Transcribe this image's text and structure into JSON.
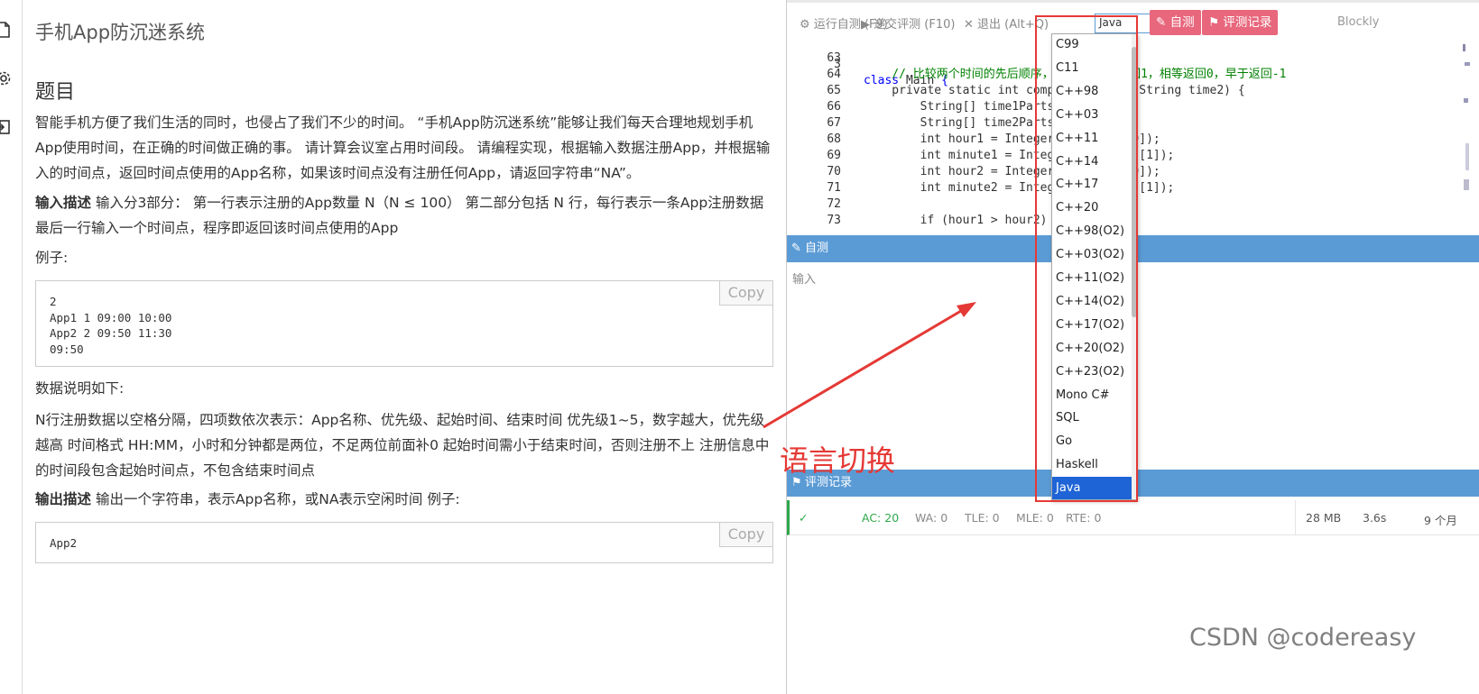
{
  "problem": {
    "title": "手机App防沉迷系统",
    "section_heading": "题目",
    "description": "智能手机方便了我们生活的同时，也侵占了我们不少的时间。 “手机App防沉迷系统”能够让我们每天合理地规划手机App使用时间，在正确的时间做正确的事。 请计算会议室占用时间段。 请编程实现，根据输入数据注册App，并根据输入的时间点，返回时间点使用的App名称，如果该时间点没有注册任何App，请返回字符串“NA”。",
    "input_label": "输入描述",
    "input_text": " 输入分3部分： 第一行表示注册的App数量 N（N ≤ 100） 第二部分包括 N 行，每行表示一条App注册数据 最后一行输入一个时间点，程序即返回该时间点使用的App",
    "example_label": "例子:",
    "example_input": "2\nApp1 1 09:00 10:00\nApp2 2 09:50 11:30\n09:50",
    "copy_label": "Copy",
    "data_note_label": "数据说明如下:",
    "data_note_text": "N行注册数据以空格分隔，四项数依次表示：App名称、优先级、起始时间、结束时间 优先级1~5，数字越大，优先级越高 时间格式 HH:MM，小时和分钟都是两位，不足两位前面补0 起始时间需小于结束时间，否则注册不上 注册信息中的时间段包含起始时间点，不包含结束时间点",
    "output_label": "输出描述",
    "output_text": " 输出一个字符串，表示App名称，或NA表示空闲时间 例子:",
    "example_output": "App2"
  },
  "toolbar": {
    "run_label": "运行自测 (F9)",
    "submit_label": "递交评测 (F10)",
    "exit_label": "退出 (Alt+Q)",
    "language_value": "Java",
    "selftest_label": "自测",
    "records_label": "评测记录",
    "blockly_label": "Blockly"
  },
  "code": {
    "sticky_line": {
      "num": "3",
      "text": "class Main {"
    },
    "lines": [
      {
        "num": "63",
        "text": ""
      },
      {
        "num": "64",
        "text": "    // 比较两个时间的先后顺序，如果t… 2则返回1，相等返回0，早于返回-1"
      },
      {
        "num": "65",
        "text": "    private static int compareT… ime1, String time2) {"
      },
      {
        "num": "66",
        "text": "        String[] time1Parts = t… :\");"
      },
      {
        "num": "67",
        "text": "        String[] time2Parts = t… :\");"
      },
      {
        "num": "68",
        "text": "        int hour1 = Integer.par… arts[0]);"
      },
      {
        "num": "69",
        "text": "        int minute1 = Integer.p… 1Parts[1]);"
      },
      {
        "num": "70",
        "text": "        int hour2 = Integer.par… arts[0]);"
      },
      {
        "num": "71",
        "text": "        int minute2 = Integer.p… 2Parts[1]);"
      },
      {
        "num": "72",
        "text": ""
      },
      {
        "num": "73",
        "text": "        if (hour1 > hour2) {"
      }
    ]
  },
  "selftest_panel": {
    "title": "自测",
    "input_placeholder": "输入"
  },
  "records_panel": {
    "title": "评测记录",
    "ac": "AC: 20",
    "wa": "WA: 0",
    "tle": "TLE: 0",
    "mle": "MLE: 0",
    "rte": "RTE: 0",
    "memory": "28 MB",
    "time": "3.6s",
    "extra": "9 个月"
  },
  "language_dropdown": {
    "options": [
      "C99",
      "C11",
      "C++98",
      "C++03",
      "C++11",
      "C++14",
      "C++17",
      "C++20",
      "C++98(O2)",
      "C++03(O2)",
      "C++11(O2)",
      "C++14(O2)",
      "C++17(O2)",
      "C++20(O2)",
      "C++23(O2)",
      "Mono C#",
      "SQL",
      "Go",
      "Haskell",
      "Java"
    ],
    "selected": "Java"
  },
  "annotation": {
    "text": "语言切换",
    "color": "#e53935"
  },
  "watermark": "CSDN @codereasy",
  "colors": {
    "accent_blue": "#5b9bd5",
    "button_red": "#e8677c",
    "success_green": "#2ea84a"
  }
}
